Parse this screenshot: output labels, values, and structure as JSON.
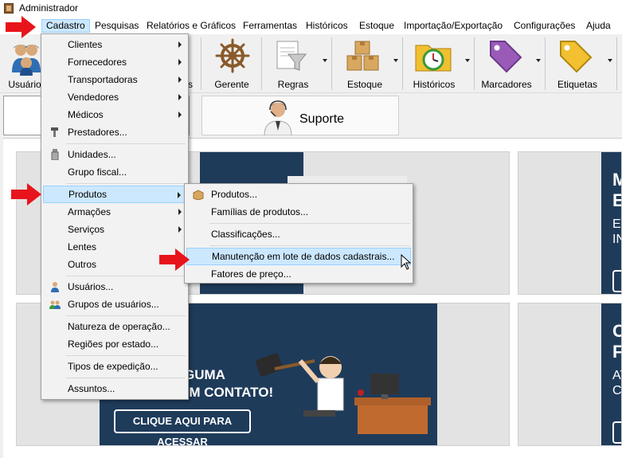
{
  "window": {
    "title": "Administrador"
  },
  "menubar": {
    "items": [
      "Cadastro",
      "Pesquisas",
      "Relatórios e Gráficos",
      "Ferramentas",
      "Históricos",
      "Estoque",
      "Importação/Exportação",
      "Configurações",
      "Ajuda"
    ],
    "active": "Cadastro"
  },
  "toolbar": {
    "buttons": [
      {
        "label": "Usuário",
        "icon": "users-icon"
      },
      {
        "label": "s",
        "icon": "hidden-icon"
      },
      {
        "label": "Gerente",
        "icon": "ship-wheel-icon"
      },
      {
        "label": "Regras",
        "icon": "funnel-document-icon"
      },
      {
        "label": "Estoque",
        "icon": "boxes-icon"
      },
      {
        "label": "Históricos",
        "icon": "clock-folder-icon"
      },
      {
        "label": "Marcadores",
        "icon": "tag-purple-icon"
      },
      {
        "label": "Etiquetas",
        "icon": "tag-yellow-icon"
      }
    ]
  },
  "tabs": {
    "suporte": "Suporte"
  },
  "cadastro_menu": {
    "items": [
      {
        "label": "Clientes",
        "submenu": true
      },
      {
        "label": "Fornecedores",
        "submenu": true
      },
      {
        "label": "Transportadoras",
        "submenu": true
      },
      {
        "label": "Vendedores",
        "submenu": true
      },
      {
        "label": "Médicos",
        "submenu": true
      },
      {
        "label": "Prestadores...",
        "submenu": false
      },
      {
        "label": "Unidades...",
        "submenu": false
      },
      {
        "label": "Grupo fiscal...",
        "submenu": false
      },
      {
        "label": "Produtos",
        "submenu": true,
        "highlighted": true
      },
      {
        "label": "Armações",
        "submenu": true
      },
      {
        "label": "Serviços",
        "submenu": true
      },
      {
        "label": "Lentes",
        "submenu": false
      },
      {
        "label": "Outros",
        "submenu": false
      },
      {
        "label": "Usuários...",
        "submenu": false
      },
      {
        "label": "Grupos de usuários...",
        "submenu": false
      },
      {
        "label": "Natureza de operação...",
        "submenu": false
      },
      {
        "label": "Regiões por estado...",
        "submenu": false
      },
      {
        "label": "Tipos de expedição...",
        "submenu": false
      },
      {
        "label": "Assuntos...",
        "submenu": false
      }
    ]
  },
  "produtos_submenu": {
    "items": [
      {
        "label": "Produtos..."
      },
      {
        "label": "Famílias de produtos..."
      },
      {
        "label": "Classificações..."
      },
      {
        "label": "Manutenção em lote de dados cadastrais...",
        "highlighted": true
      },
      {
        "label": "Fatores de preço..."
      }
    ]
  },
  "banners": {
    "bottom_left_line1": "GUMA",
    "bottom_left_line2": "EM CONTATO!",
    "cta": "CLIQUE AQUI PARA ACESSAR",
    "top_right": [
      "M",
      "E",
      "EE",
      "IN"
    ],
    "bottom_right": [
      "C",
      "F",
      "AT",
      "CC"
    ]
  },
  "colors": {
    "accent_highlight": "#cce8ff",
    "navy": "#1f3b5a",
    "annotation_red": "#e8141b"
  }
}
